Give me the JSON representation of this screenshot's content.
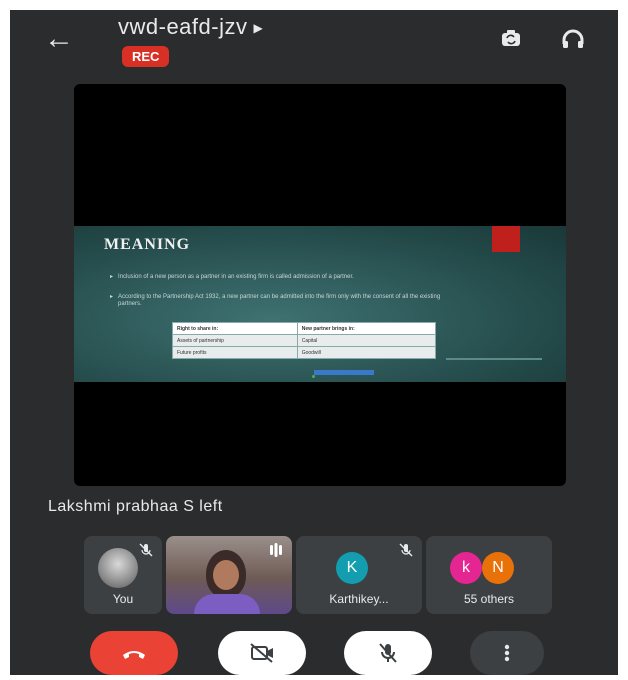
{
  "meeting": {
    "title": "vwd-eafd-jzv",
    "rec_label": "REC"
  },
  "slide": {
    "title": "MEANING",
    "bullets": [
      "Inclusion of a new person as a partner in an existing firm is called admission of a partner.",
      "According to the Partnership Act 1932, a new partner can be admitted into the firm only with the consent of all the existing partners."
    ],
    "table": [
      [
        "Right to share in:",
        "New partner brings in:"
      ],
      [
        "Assets of partnership",
        "Capital"
      ],
      [
        "Future profits",
        "Goodwill"
      ]
    ]
  },
  "speaker_status": "Lakshmi prabhaa S left",
  "participants": [
    {
      "label": "You",
      "muted": true
    },
    {
      "label": "",
      "muted": false,
      "video": true
    },
    {
      "label": "Karthikey...",
      "initial": "K",
      "avatar_color": "#129eaf",
      "muted": true
    },
    {
      "label": "55 others",
      "initials": [
        "k",
        "N"
      ],
      "avatar_colors": [
        "#e52592",
        "#e8710a"
      ]
    }
  ],
  "colors": {
    "rec": "#d93025",
    "end_call": "#ea4335",
    "background": "#2b2c2e",
    "tile": "#3c4043"
  },
  "icons": {
    "back": "arrow-left-icon",
    "switch_camera": "switch-camera-icon",
    "audio": "headphones-icon",
    "end_call": "phone-hangup-icon",
    "camera": "camera-off-icon",
    "mic": "mic-off-icon",
    "more": "more-vert-icon"
  }
}
